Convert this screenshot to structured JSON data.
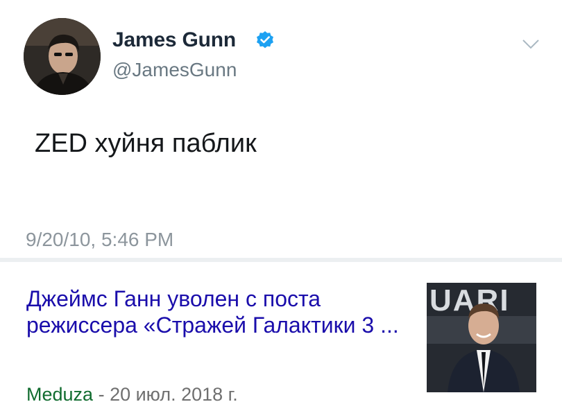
{
  "tweet": {
    "author_name": "James Gunn",
    "handle": "@JamesGunn",
    "text": "ZED хуйня паблик",
    "timestamp": "9/20/10, 5:46 PM",
    "verified": true
  },
  "news": {
    "title": "Джеймс Ганн уволен с поста режиссера «Стражей Галактики 3 ...",
    "source": "Meduza",
    "separator": " - ",
    "date": "20 июл. 2018 г.",
    "thumbnail_banner_text": "UARI"
  },
  "colors": {
    "name": "#1c2938",
    "handle": "#697882",
    "verified_badge": "#1da1f2",
    "link": "#1a0dab",
    "source": "#116c2f",
    "meta": "#6f6f6f",
    "divider": "#eceff1"
  },
  "icons": [
    "verified-badge-icon",
    "chevron-down-icon"
  ]
}
